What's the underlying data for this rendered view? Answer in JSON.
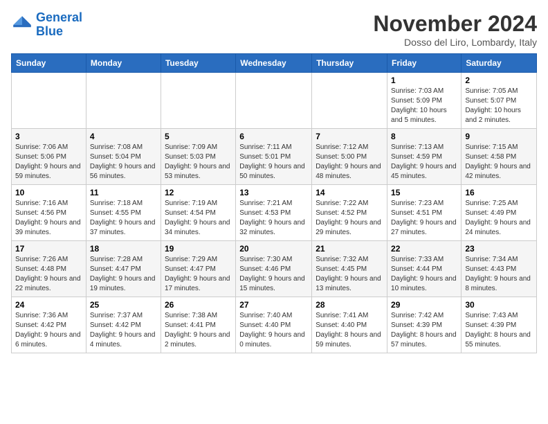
{
  "logo": {
    "line1": "General",
    "line2": "Blue"
  },
  "title": "November 2024",
  "location": "Dosso del Liro, Lombardy, Italy",
  "header_days": [
    "Sunday",
    "Monday",
    "Tuesday",
    "Wednesday",
    "Thursday",
    "Friday",
    "Saturday"
  ],
  "weeks": [
    [
      {
        "day": "",
        "info": ""
      },
      {
        "day": "",
        "info": ""
      },
      {
        "day": "",
        "info": ""
      },
      {
        "day": "",
        "info": ""
      },
      {
        "day": "",
        "info": ""
      },
      {
        "day": "1",
        "info": "Sunrise: 7:03 AM\nSunset: 5:09 PM\nDaylight: 10 hours and 5 minutes."
      },
      {
        "day": "2",
        "info": "Sunrise: 7:05 AM\nSunset: 5:07 PM\nDaylight: 10 hours and 2 minutes."
      }
    ],
    [
      {
        "day": "3",
        "info": "Sunrise: 7:06 AM\nSunset: 5:06 PM\nDaylight: 9 hours and 59 minutes."
      },
      {
        "day": "4",
        "info": "Sunrise: 7:08 AM\nSunset: 5:04 PM\nDaylight: 9 hours and 56 minutes."
      },
      {
        "day": "5",
        "info": "Sunrise: 7:09 AM\nSunset: 5:03 PM\nDaylight: 9 hours and 53 minutes."
      },
      {
        "day": "6",
        "info": "Sunrise: 7:11 AM\nSunset: 5:01 PM\nDaylight: 9 hours and 50 minutes."
      },
      {
        "day": "7",
        "info": "Sunrise: 7:12 AM\nSunset: 5:00 PM\nDaylight: 9 hours and 48 minutes."
      },
      {
        "day": "8",
        "info": "Sunrise: 7:13 AM\nSunset: 4:59 PM\nDaylight: 9 hours and 45 minutes."
      },
      {
        "day": "9",
        "info": "Sunrise: 7:15 AM\nSunset: 4:58 PM\nDaylight: 9 hours and 42 minutes."
      }
    ],
    [
      {
        "day": "10",
        "info": "Sunrise: 7:16 AM\nSunset: 4:56 PM\nDaylight: 9 hours and 39 minutes."
      },
      {
        "day": "11",
        "info": "Sunrise: 7:18 AM\nSunset: 4:55 PM\nDaylight: 9 hours and 37 minutes."
      },
      {
        "day": "12",
        "info": "Sunrise: 7:19 AM\nSunset: 4:54 PM\nDaylight: 9 hours and 34 minutes."
      },
      {
        "day": "13",
        "info": "Sunrise: 7:21 AM\nSunset: 4:53 PM\nDaylight: 9 hours and 32 minutes."
      },
      {
        "day": "14",
        "info": "Sunrise: 7:22 AM\nSunset: 4:52 PM\nDaylight: 9 hours and 29 minutes."
      },
      {
        "day": "15",
        "info": "Sunrise: 7:23 AM\nSunset: 4:51 PM\nDaylight: 9 hours and 27 minutes."
      },
      {
        "day": "16",
        "info": "Sunrise: 7:25 AM\nSunset: 4:49 PM\nDaylight: 9 hours and 24 minutes."
      }
    ],
    [
      {
        "day": "17",
        "info": "Sunrise: 7:26 AM\nSunset: 4:48 PM\nDaylight: 9 hours and 22 minutes."
      },
      {
        "day": "18",
        "info": "Sunrise: 7:28 AM\nSunset: 4:47 PM\nDaylight: 9 hours and 19 minutes."
      },
      {
        "day": "19",
        "info": "Sunrise: 7:29 AM\nSunset: 4:47 PM\nDaylight: 9 hours and 17 minutes."
      },
      {
        "day": "20",
        "info": "Sunrise: 7:30 AM\nSunset: 4:46 PM\nDaylight: 9 hours and 15 minutes."
      },
      {
        "day": "21",
        "info": "Sunrise: 7:32 AM\nSunset: 4:45 PM\nDaylight: 9 hours and 13 minutes."
      },
      {
        "day": "22",
        "info": "Sunrise: 7:33 AM\nSunset: 4:44 PM\nDaylight: 9 hours and 10 minutes."
      },
      {
        "day": "23",
        "info": "Sunrise: 7:34 AM\nSunset: 4:43 PM\nDaylight: 9 hours and 8 minutes."
      }
    ],
    [
      {
        "day": "24",
        "info": "Sunrise: 7:36 AM\nSunset: 4:42 PM\nDaylight: 9 hours and 6 minutes."
      },
      {
        "day": "25",
        "info": "Sunrise: 7:37 AM\nSunset: 4:42 PM\nDaylight: 9 hours and 4 minutes."
      },
      {
        "day": "26",
        "info": "Sunrise: 7:38 AM\nSunset: 4:41 PM\nDaylight: 9 hours and 2 minutes."
      },
      {
        "day": "27",
        "info": "Sunrise: 7:40 AM\nSunset: 4:40 PM\nDaylight: 9 hours and 0 minutes."
      },
      {
        "day": "28",
        "info": "Sunrise: 7:41 AM\nSunset: 4:40 PM\nDaylight: 8 hours and 59 minutes."
      },
      {
        "day": "29",
        "info": "Sunrise: 7:42 AM\nSunset: 4:39 PM\nDaylight: 8 hours and 57 minutes."
      },
      {
        "day": "30",
        "info": "Sunrise: 7:43 AM\nSunset: 4:39 PM\nDaylight: 8 hours and 55 minutes."
      }
    ]
  ]
}
